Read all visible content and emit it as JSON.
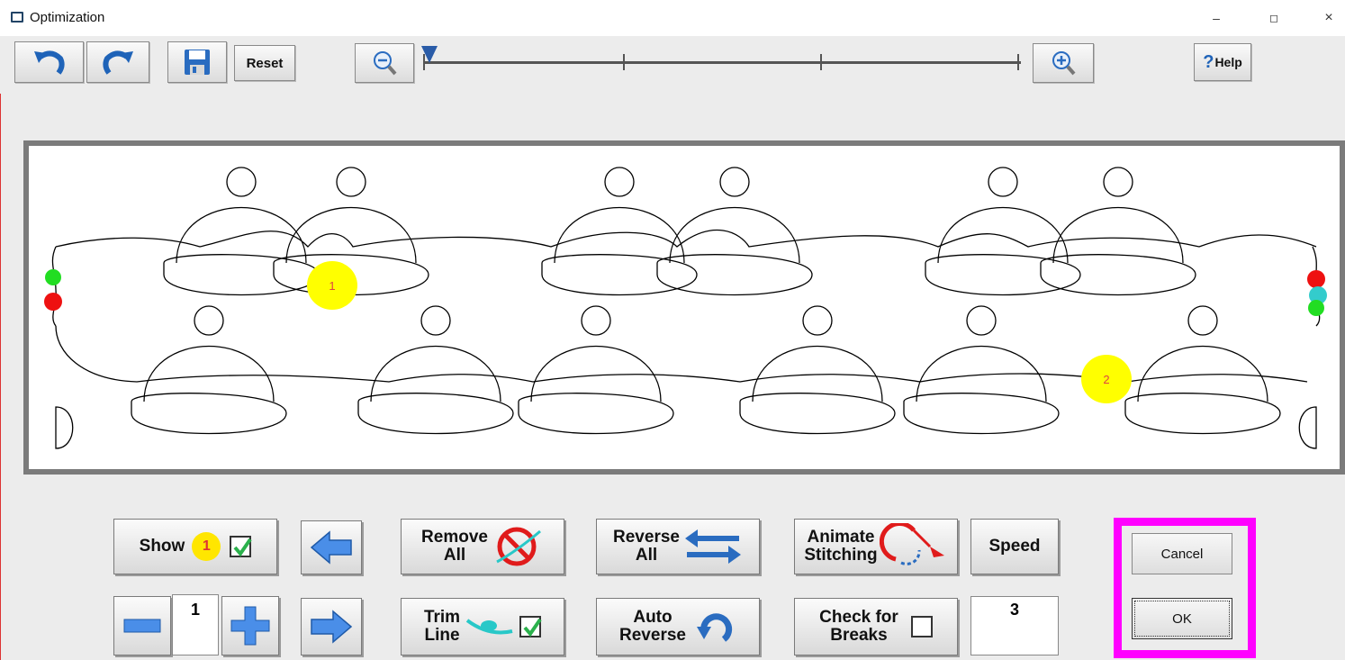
{
  "window": {
    "title": "Optimization",
    "controls": {
      "minimize": "–",
      "restore": "◻",
      "close": "×"
    }
  },
  "toolbar": {
    "undo_icon": "undo-icon",
    "redo_icon": "redo-icon",
    "save_icon": "save-icon",
    "reset_label": "Reset",
    "zoom_out_icon": "zoom-out-icon",
    "zoom_in_icon": "zoom-in-icon",
    "zoom_level": 0,
    "help_mark": "?",
    "help_label": "Help"
  },
  "canvas": {
    "markers": [
      {
        "label": "1"
      },
      {
        "label": "2"
      }
    ],
    "colors": {
      "start": "#22dd22",
      "end": "#ee1111",
      "link": "#33cccc",
      "marker": "#ffff00"
    }
  },
  "controls": {
    "show_label": "Show",
    "show_badge": "1",
    "show_checked": true,
    "prev_icon": "arrow-left-icon",
    "next_icon": "arrow-right-icon",
    "minus_icon": "minus-icon",
    "plus_icon": "plus-icon",
    "stitch_number": "1",
    "remove_all_line1": "Remove",
    "remove_all_line2": "All",
    "trim_line_line1": "Trim",
    "trim_line_line2": "Line",
    "trim_line_checked": true,
    "reverse_all_line1": "Reverse",
    "reverse_all_line2": "All",
    "auto_reverse_line1": "Auto",
    "auto_reverse_line2": "Reverse",
    "animate_line1": "Animate",
    "animate_line2": "Stitching",
    "check_breaks_line1": "Check for",
    "check_breaks_line2": "Breaks",
    "check_breaks_checked": false,
    "speed_label": "Speed",
    "speed_value": "3"
  },
  "dialog": {
    "cancel_label": "Cancel",
    "ok_label": "OK",
    "highlight_color": "#ff00ff"
  }
}
